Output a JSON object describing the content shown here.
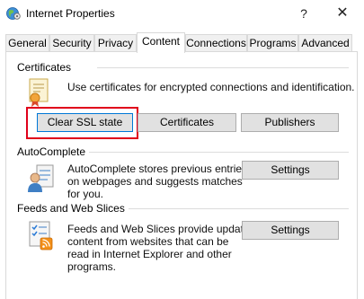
{
  "window": {
    "title": "Internet Properties",
    "help_label": "?",
    "close_label": "✕"
  },
  "tabs": [
    {
      "label": "General"
    },
    {
      "label": "Security"
    },
    {
      "label": "Privacy"
    },
    {
      "label": "Content"
    },
    {
      "label": "Connections"
    },
    {
      "label": "Programs"
    },
    {
      "label": "Advanced"
    }
  ],
  "certificates": {
    "title": "Certificates",
    "description": "Use certificates for encrypted connections and identification.",
    "clear_ssl_label": "Clear SSL state",
    "certificates_label": "Certificates",
    "publishers_label": "Publishers"
  },
  "autocomplete": {
    "title": "AutoComplete",
    "description_lines": [
      "AutoComplete stores previous entries",
      "on webpages and suggests matches",
      "for you."
    ],
    "settings_label": "Settings"
  },
  "feeds": {
    "title": "Feeds and Web Slices",
    "description_lines": [
      "Feeds and Web Slices provide updated",
      "content from websites that can be",
      "read in Internet Explorer and other",
      "programs."
    ],
    "settings_label": "Settings"
  },
  "colors": {
    "highlight": "#e0001a",
    "focus_border": "#0078d7"
  }
}
